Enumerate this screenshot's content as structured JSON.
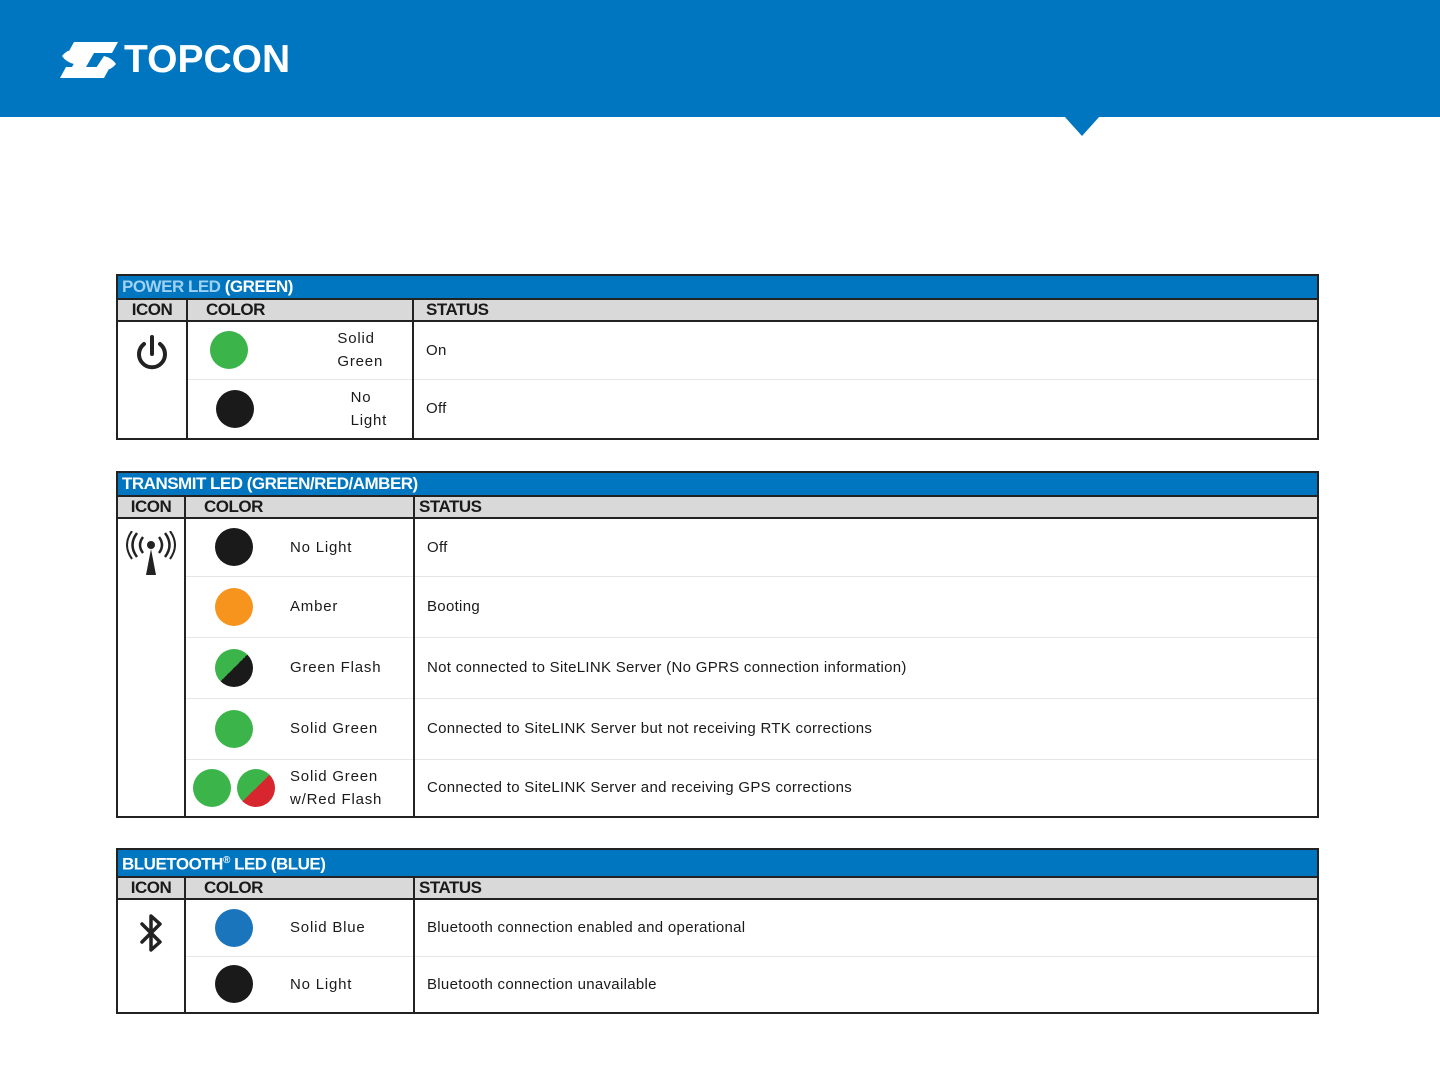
{
  "brand": {
    "name": "TOPCON",
    "logo_icon": "topcon-logo-icon"
  },
  "colors": {
    "header_blue": "#0076c0",
    "green": "#3bb44a",
    "black": "#1a1a1a",
    "amber": "#f7941d",
    "red": "#d7262e",
    "blue": "#1b75bc"
  },
  "power": {
    "title_main": "POWER LED",
    "title_color": "(GREEN)",
    "headers": {
      "icon": "ICON",
      "color": "COLOR",
      "status": "STATUS"
    },
    "icon": "power-icon",
    "rows": [
      {
        "color_label": "Solid Green",
        "status": "On"
      },
      {
        "color_label": "No Light",
        "status": "Off"
      }
    ]
  },
  "transmit": {
    "title": "TRANSMIT LED (GREEN/RED/AMBER)",
    "headers": {
      "icon": "ICON",
      "color": "COLOR",
      "status": "STATUS"
    },
    "icon": "antenna-icon",
    "rows": [
      {
        "color_label": "No Light",
        "status": "Off"
      },
      {
        "color_label": "Amber",
        "status": "Booting"
      },
      {
        "color_label": "Green Flash",
        "status": "Not connected to SiteLINK Server (No GPRS connection information)"
      },
      {
        "color_label": "Solid Green",
        "status": "Connected to SiteLINK Server but not receiving RTK corrections"
      },
      {
        "color_label_1": "Solid Green",
        "color_label_2": "w/Red Flash",
        "status": "Connected to SiteLINK Server and receiving GPS corrections"
      }
    ]
  },
  "bluetooth": {
    "title": "BLUETOOTH",
    "title_mark": "®",
    "title_rest": " LED (BLUE)",
    "headers": {
      "icon": "ICON",
      "color": "COLOR",
      "status": "STATUS"
    },
    "icon": "bluetooth-icon",
    "rows": [
      {
        "color_label": "Solid Blue",
        "status": "Bluetooth connection enabled and operational"
      },
      {
        "color_label": "No Light",
        "status": "Bluetooth connection unavailable"
      }
    ]
  }
}
